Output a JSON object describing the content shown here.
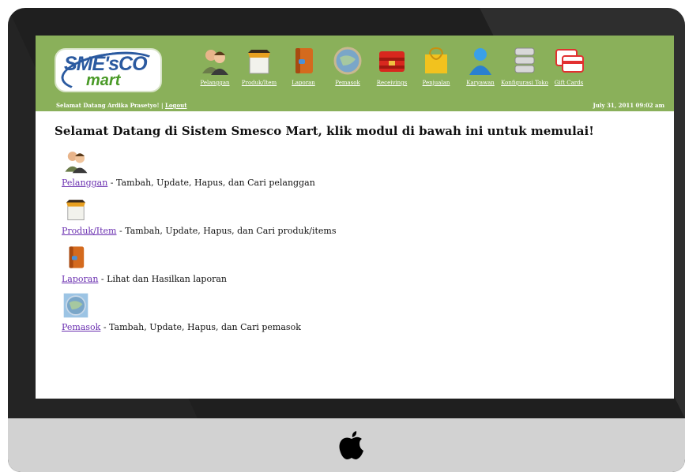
{
  "header": {
    "logo_text_top": "SME'sCO",
    "logo_text_bottom": "mart",
    "greeting": "Selamat Datang Ardika Prasetyo! | ",
    "logout_label": "Logout",
    "date": "July 31, 2011 09:02 am"
  },
  "nav": {
    "items": [
      {
        "label": "Pelanggan",
        "icon": "users-icon"
      },
      {
        "label": "Produk/Item",
        "icon": "box-icon"
      },
      {
        "label": "Laporan",
        "icon": "book-icon"
      },
      {
        "label": "Pemasok",
        "icon": "globe-icon"
      },
      {
        "label": "Receivings",
        "icon": "crate-icon"
      },
      {
        "label": "Penjualan",
        "icon": "shopping-bag-icon"
      },
      {
        "label": "Karyawan",
        "icon": "person-icon"
      },
      {
        "label": "Konfigurasi Toko",
        "icon": "database-icon"
      },
      {
        "label": "Gift Cards",
        "icon": "gift-card-icon"
      }
    ]
  },
  "main": {
    "welcome": "Selamat Datang di Sistem Smesco Mart, klik modul di bawah ini untuk memulai!",
    "modules": [
      {
        "link": "Pelanggan",
        "desc": " - Tambah, Update, Hapus, dan Cari pelanggan"
      },
      {
        "link": "Produk/Item",
        "desc": " - Tambah, Update, Hapus, dan Cari produk/items"
      },
      {
        "link": "Laporan",
        "desc": " - Lihat dan Hasilkan laporan"
      },
      {
        "link": "Pemasok",
        "desc": " - Tambah, Update, Hapus, dan Cari pemasok"
      }
    ]
  },
  "colors": {
    "header_bg": "#8ab05a",
    "link": "#6a2fb0",
    "bezel": "#1f1f1f",
    "chin": "#d2d2d2"
  }
}
